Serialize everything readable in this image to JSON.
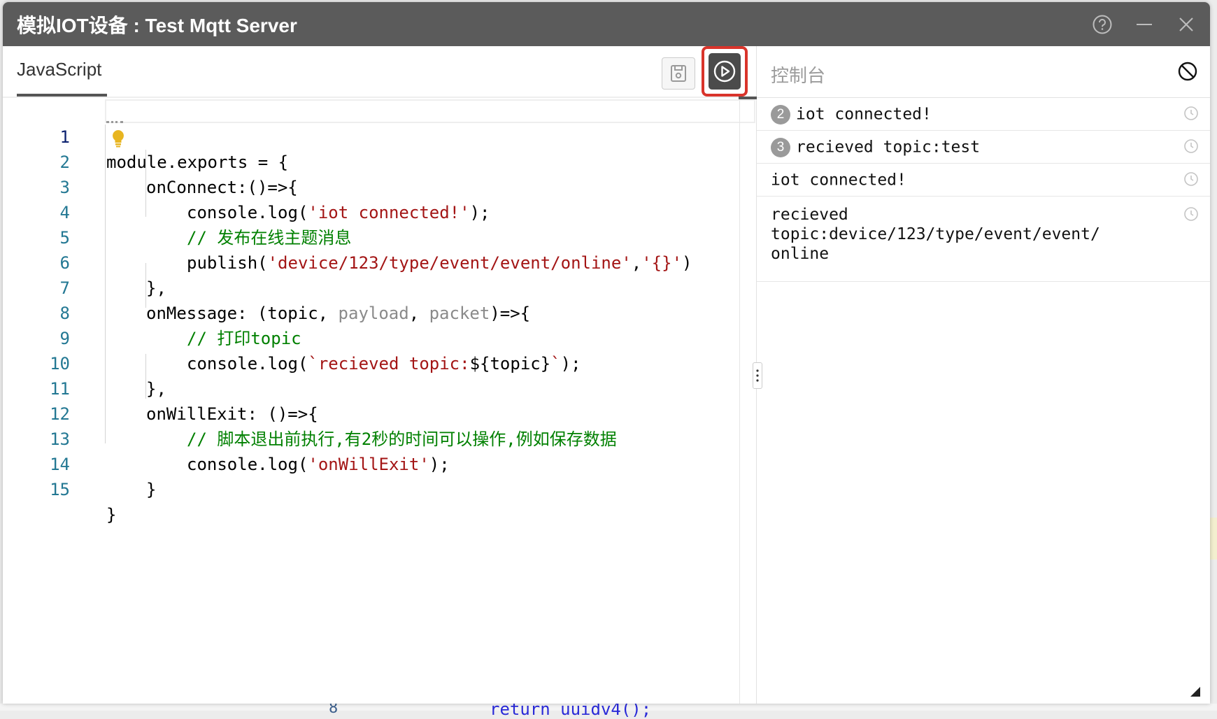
{
  "window": {
    "title": "模拟IOT设备 : Test Mqtt Server",
    "controls": [
      "help-icon",
      "minimize-icon",
      "close-icon"
    ]
  },
  "editor": {
    "tab_label": "JavaScript",
    "save_button_icon": "save-icon",
    "run_button_icon": "play-circle-icon",
    "lines": [
      {
        "n": "1",
        "text": "module.exports = {"
      },
      {
        "n": "2",
        "text": "onConnect:()=>{"
      },
      {
        "n": "3",
        "pre": "console.log(",
        "str": "'iot connected!'",
        "post": ");"
      },
      {
        "n": "4",
        "comment": "// 发布在线主题消息"
      },
      {
        "n": "5",
        "pre": "publish(",
        "str": "'device/123/type/event/event/online'",
        "mid": ",",
        "str2": "'{}'",
        "post": ")"
      },
      {
        "n": "6",
        "text": "},"
      },
      {
        "n": "7",
        "pre": "onMessage: (topic, ",
        "dim": "payload",
        "mid": ", ",
        "dim2": "packet",
        "post": ")=>{"
      },
      {
        "n": "8",
        "comment": "// 打印topic"
      },
      {
        "n": "9",
        "pre": "console.log(",
        "str": "`recieved topic:",
        "mid": "${topic}",
        "str2": "`",
        "post": ");"
      },
      {
        "n": "10",
        "text": "},"
      },
      {
        "n": "11",
        "text": "onWillExit: ()=>{"
      },
      {
        "n": "12",
        "comment": "// 脚本退出前执行,有2秒的时间可以操作,例如保存数据"
      },
      {
        "n": "13",
        "pre": "console.log(",
        "str": "'onWillExit'",
        "post": ");"
      },
      {
        "n": "14",
        "text": "}"
      },
      {
        "n": "15",
        "text": "}"
      }
    ]
  },
  "console": {
    "title": "控制台",
    "clear_icon": "clear-console-icon",
    "logs": [
      {
        "count": "2",
        "text": "iot connected!"
      },
      {
        "count": "3",
        "text": "recieved topic:test"
      },
      {
        "count": "",
        "text": "iot connected!"
      },
      {
        "count": "",
        "text": "recieved topic:device/123/type/event/event/",
        "text2": "online"
      }
    ]
  },
  "background": {
    "line_number": "8",
    "code": "return uuidv4();"
  }
}
